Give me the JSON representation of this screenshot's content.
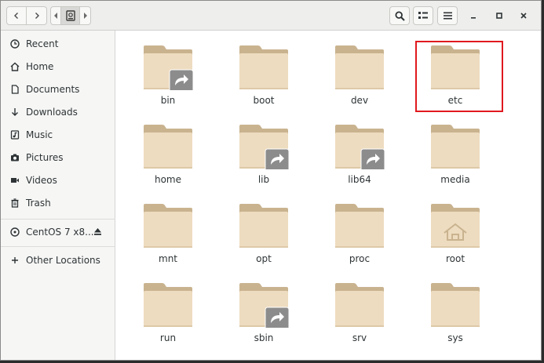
{
  "toolbar": {
    "back_icon": "chevron-left-icon",
    "forward_icon": "chevron-right-icon",
    "path_prev_icon": "chevron-left-small-icon",
    "path_root_icon": "drive-icon",
    "path_next_icon": "chevron-right-small-icon",
    "search_icon": "search-icon",
    "view_toggle_icon": "list-view-icon",
    "menu_icon": "hamburger-menu-icon",
    "minimize_label": "–",
    "maximize_label": "□",
    "close_label": "×"
  },
  "sidebar": {
    "places": [
      {
        "label": "Recent",
        "icon": "clock-icon"
      },
      {
        "label": "Home",
        "icon": "home-icon"
      },
      {
        "label": "Documents",
        "icon": "document-icon"
      },
      {
        "label": "Downloads",
        "icon": "download-arrow-icon"
      },
      {
        "label": "Music",
        "icon": "music-note-icon"
      },
      {
        "label": "Pictures",
        "icon": "camera-icon"
      },
      {
        "label": "Videos",
        "icon": "video-icon"
      },
      {
        "label": "Trash",
        "icon": "trash-icon"
      }
    ],
    "devices": [
      {
        "label": "CentOS 7 x8...",
        "icon": "disc-icon",
        "eject_icon": "eject-icon"
      }
    ],
    "other": {
      "label": "Other Locations",
      "icon": "plus-icon"
    }
  },
  "files": [
    {
      "name": "bin",
      "link": true,
      "home": false
    },
    {
      "name": "boot",
      "link": false,
      "home": false
    },
    {
      "name": "dev",
      "link": false,
      "home": false
    },
    {
      "name": "etc",
      "link": false,
      "home": false,
      "selected": true
    },
    {
      "name": "home",
      "link": false,
      "home": false
    },
    {
      "name": "lib",
      "link": true,
      "home": false
    },
    {
      "name": "lib64",
      "link": true,
      "home": false
    },
    {
      "name": "media",
      "link": false,
      "home": false
    },
    {
      "name": "mnt",
      "link": false,
      "home": false
    },
    {
      "name": "opt",
      "link": false,
      "home": false
    },
    {
      "name": "proc",
      "link": false,
      "home": false
    },
    {
      "name": "root",
      "link": false,
      "home": true
    },
    {
      "name": "run",
      "link": false,
      "home": false
    },
    {
      "name": "sbin",
      "link": true,
      "home": false
    },
    {
      "name": "srv",
      "link": false,
      "home": false
    },
    {
      "name": "sys",
      "link": false,
      "home": false
    }
  ],
  "colors": {
    "folder_body": "#eedcc0",
    "folder_tab": "#c9b38f",
    "link_badge": "#8c8c8c",
    "selection_outline": "#e0191f"
  }
}
